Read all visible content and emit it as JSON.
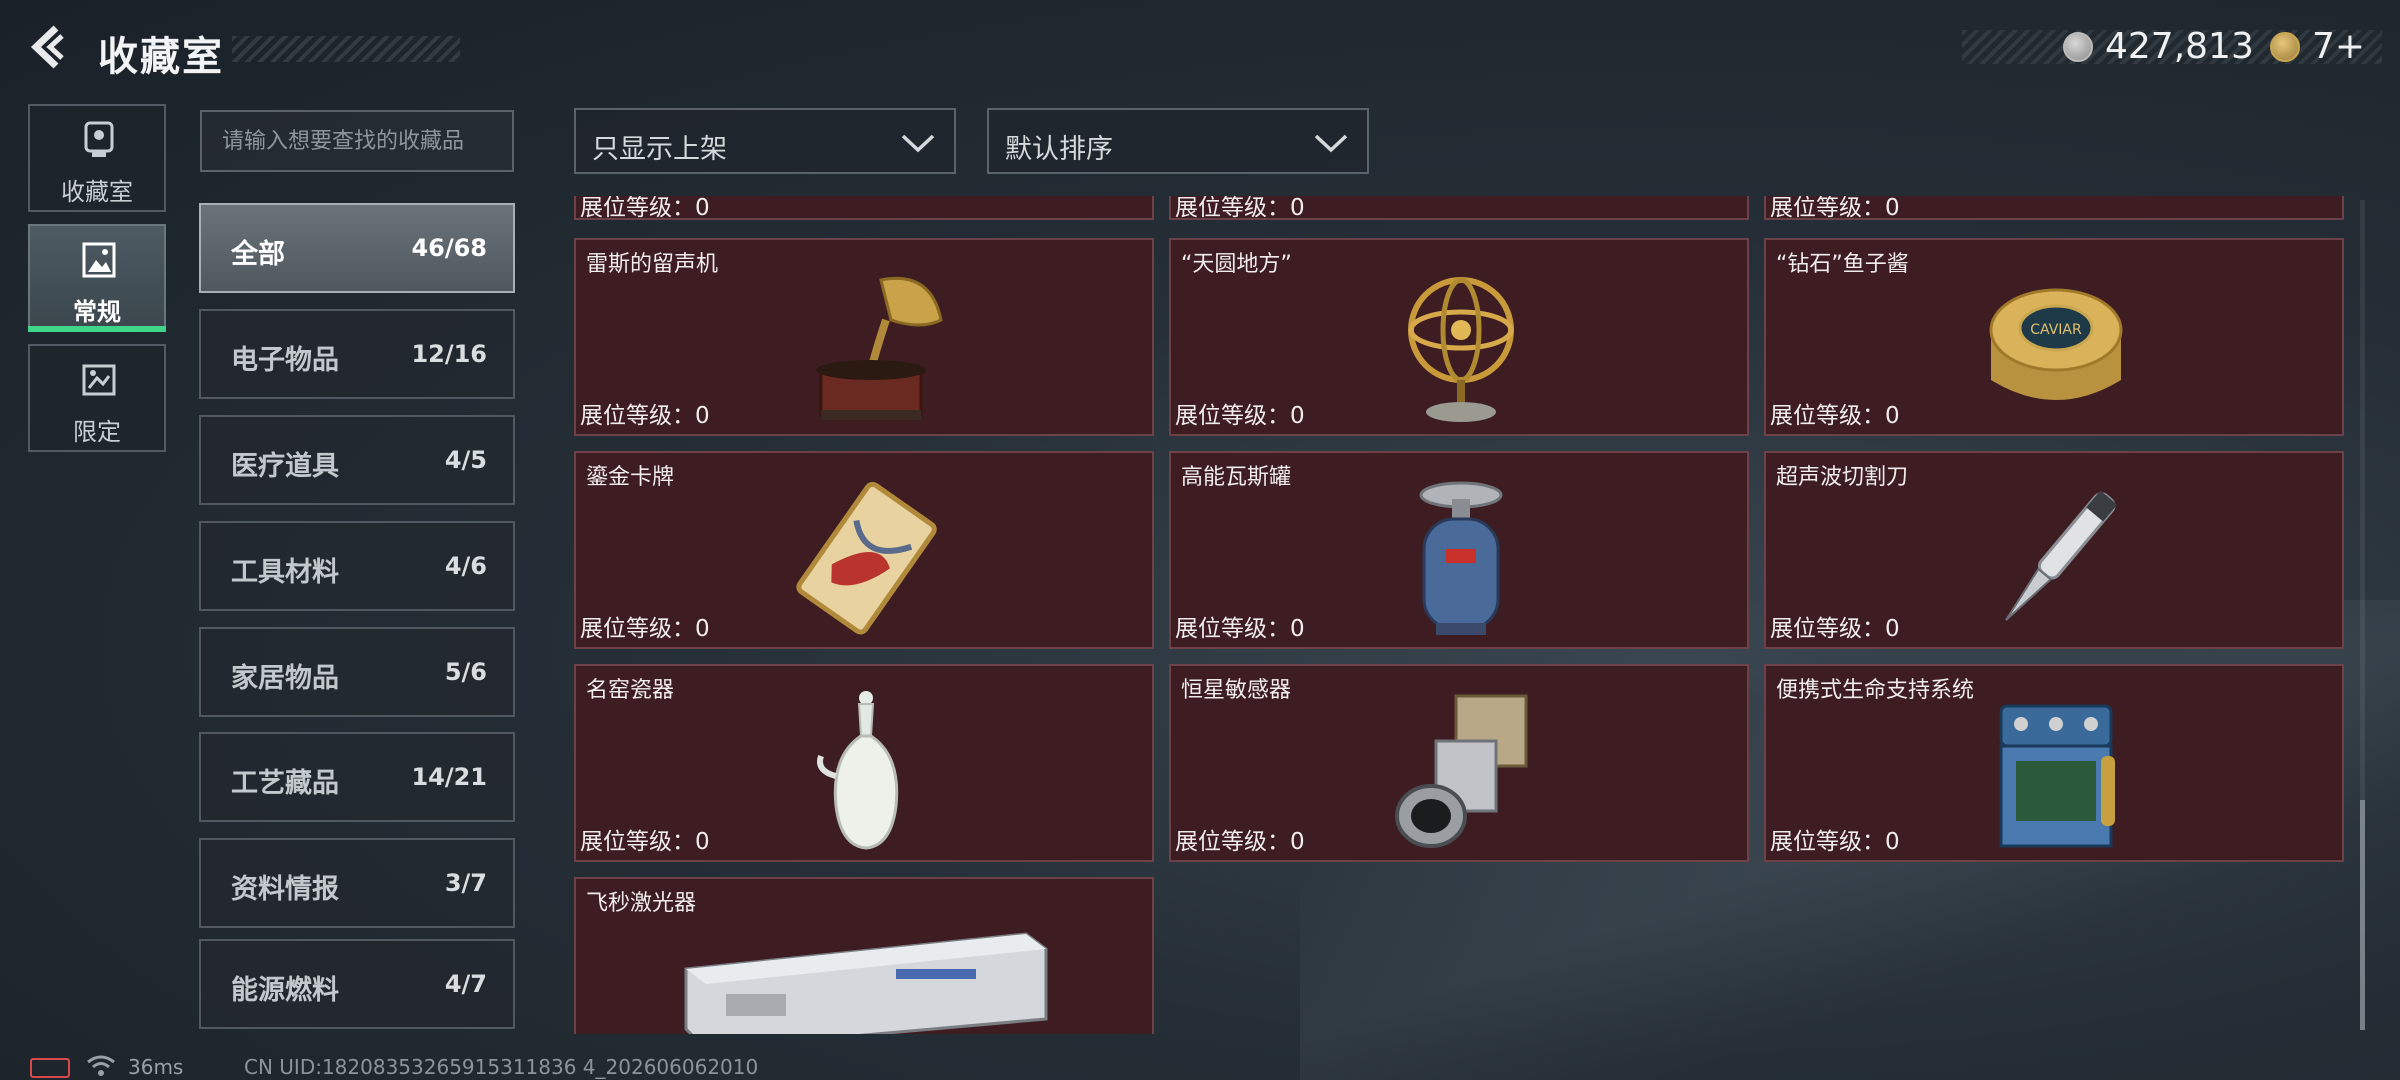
{
  "header": {
    "title": "收藏室",
    "coins": "427,813",
    "tickets": "7+"
  },
  "nav": {
    "tabs": [
      {
        "label": "收藏室",
        "icon": "trophy-icon",
        "active": false
      },
      {
        "label": "常规",
        "icon": "picture-icon",
        "active": true
      },
      {
        "label": "限定",
        "icon": "limited-icon",
        "active": false
      }
    ]
  },
  "search": {
    "placeholder": "请输入想要查找的收藏品"
  },
  "filters": {
    "show": "只显示上架",
    "sort": "默认排序"
  },
  "categories": [
    {
      "label": "全部",
      "count": "46/68",
      "active": true
    },
    {
      "label": "电子物品",
      "count": "12/16"
    },
    {
      "label": "医疗道具",
      "count": "4/5"
    },
    {
      "label": "工具材料",
      "count": "4/6"
    },
    {
      "label": "家居物品",
      "count": "5/6"
    },
    {
      "label": "工艺藏品",
      "count": "14/21"
    },
    {
      "label": "资料情报",
      "count": "3/7"
    },
    {
      "label": "能源燃料",
      "count": "4/7"
    }
  ],
  "level_label": "展位等级：",
  "items": [
    {
      "name": "",
      "level": "0",
      "partial": true,
      "icon": "item-icon"
    },
    {
      "name": "",
      "level": "0",
      "partial": true,
      "icon": "item-icon"
    },
    {
      "name": "",
      "level": "0",
      "partial": true,
      "icon": "item-icon"
    },
    {
      "name": "雷斯的留声机",
      "level": "0",
      "icon": "gramophone-icon"
    },
    {
      "name": "“天圆地方”",
      "level": "0",
      "icon": "armillary-sphere-icon"
    },
    {
      "name": "“钻石”鱼子酱",
      "level": "0",
      "icon": "caviar-tin-icon"
    },
    {
      "name": "鎏金卡牌",
      "level": "0",
      "icon": "gilded-card-icon"
    },
    {
      "name": "高能瓦斯罐",
      "level": "0",
      "icon": "gas-canister-icon"
    },
    {
      "name": "超声波切割刀",
      "level": "0",
      "icon": "ultrasonic-knife-icon"
    },
    {
      "name": "名窑瓷器",
      "level": "0",
      "icon": "porcelain-vase-icon"
    },
    {
      "name": "恒星敏感器",
      "level": "0",
      "icon": "star-sensor-icon"
    },
    {
      "name": "便携式生命支持系统",
      "level": "0",
      "icon": "life-support-icon"
    },
    {
      "name": "飞秒激光器",
      "level": "",
      "icon": "femtosecond-laser-icon"
    }
  ],
  "caviar_text": "CAVIAR",
  "status": {
    "ping": "36ms",
    "uid": "CN UID:18208353265915311836 4_202606062010"
  },
  "colors": {
    "card_bg": "#3d1c22",
    "accent_green": "#3fd68a"
  }
}
